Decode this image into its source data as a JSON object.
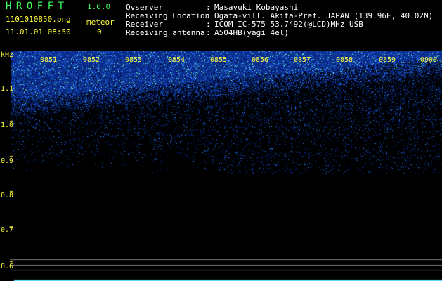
{
  "app": {
    "title": "HROFFT",
    "version": "1.0.0"
  },
  "file": {
    "name": "1101010850.png",
    "datetime": "11.01.01 08:50"
  },
  "meteor": {
    "label": "meteor",
    "count": "0"
  },
  "info": [
    {
      "label": "Ovserver",
      "value": "Masayuki Kobayashi"
    },
    {
      "label": "Receiving Location",
      "value": "Ogata-vill. Akita-Pref. JAPAN (139.96E, 40.02N)"
    },
    {
      "label": "Receiver",
      "value": "ICOM IC-575 53.7492(@LCD)MHz USB"
    },
    {
      "label": "Receiving antenna",
      "value": "A504HB(yagi 4el)"
    }
  ],
  "spectrogram": {
    "unit": "kHz",
    "freq_ticks": [
      "1.1",
      "1.0",
      "0.9",
      "0.8",
      "0.7",
      "0.6"
    ],
    "time_ticks": [
      "0851",
      "0852",
      "0853",
      "0854",
      "0855",
      "0856",
      "0857",
      "0858",
      "0859",
      "0900"
    ],
    "colors": {
      "background": "#000000",
      "signal_low": "#0a1a8c",
      "signal_mid": "#2e7dff",
      "signal_high": "#7dffd2",
      "label": "#ffff3c",
      "title": "#3cff5a",
      "rule": "#808080"
    }
  }
}
